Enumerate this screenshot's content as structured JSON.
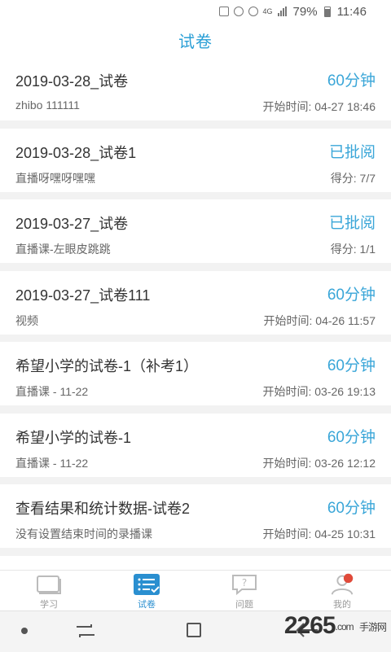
{
  "status_bar": {
    "network": "4G",
    "battery": "79%",
    "time": "11:46"
  },
  "header": {
    "title": "试卷"
  },
  "papers": [
    {
      "name": "2019-03-28_试卷",
      "status": "60分钟",
      "subtitle": "zhibo 111111",
      "meta": "开始时间: 04-27 18:46"
    },
    {
      "name": "2019-03-28_试卷1",
      "status": "已批阅",
      "subtitle": "直播呀嘿呀嘿嘿",
      "meta": "得分: 7/7"
    },
    {
      "name": "2019-03-27_试卷",
      "status": "已批阅",
      "subtitle": "直播课-左眼皮跳跳",
      "meta": "得分: 1/1"
    },
    {
      "name": "2019-03-27_试卷111",
      "status": "60分钟",
      "subtitle": "视频",
      "meta": "开始时间: 04-26 11:57"
    },
    {
      "name": "希望小学的试卷-1（补考1）",
      "status": "60分钟",
      "subtitle": "直播课 - 11-22",
      "meta": "开始时间: 03-26 19:13"
    },
    {
      "name": "希望小学的试卷-1",
      "status": "60分钟",
      "subtitle": "直播课 - 11-22",
      "meta": "开始时间: 03-26 12:12"
    },
    {
      "name": "查看结果和统计数据-试卷2",
      "status": "60分钟",
      "subtitle": "没有设置结束时间的录播课",
      "meta": "开始时间: 04-25 10:31"
    }
  ],
  "tabs": [
    {
      "label": "学习",
      "icon": "book-icon"
    },
    {
      "label": "试卷",
      "icon": "exam-list-icon",
      "active": true
    },
    {
      "label": "问题",
      "icon": "question-bubble-icon"
    },
    {
      "label": "我的",
      "icon": "profile-icon"
    }
  ],
  "watermark": {
    "main": "2265",
    "suffix": ".com",
    "sub": "手游网"
  },
  "colors": {
    "accent": "#2a9fd6",
    "status": "#3aa6d8",
    "active_tab": "#2a8fd0",
    "badge": "#e04a3a"
  }
}
